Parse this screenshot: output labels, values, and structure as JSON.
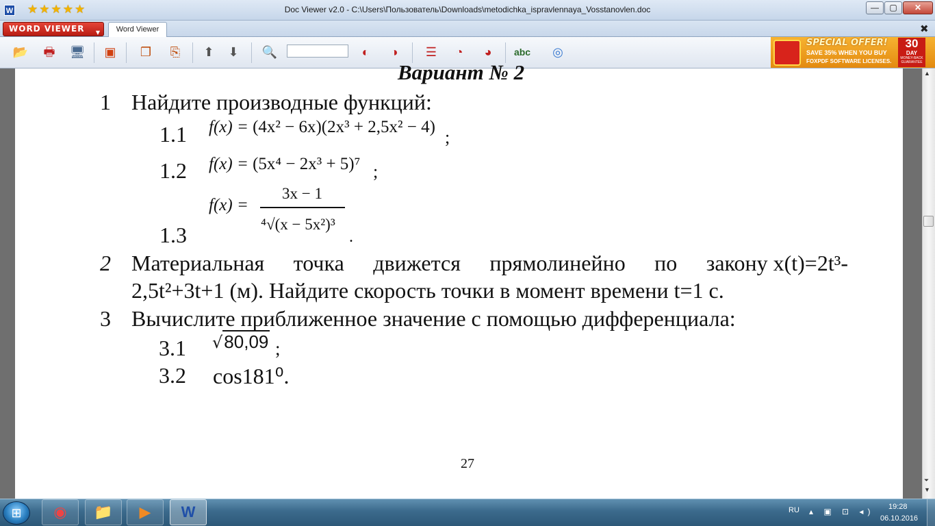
{
  "window": {
    "title": "Doc Viewer v2.0 - C:\\Users\\Пользователь\\Downloads\\metodichka_ispravlennaya_Vosstanovlen.doc",
    "app_icon_letter": "W",
    "rating_stars": "★★★★★",
    "minimize": "—",
    "maximize": "▢",
    "close": "✕"
  },
  "tabs": {
    "brand": "Word Viewer",
    "brand_arrow": "▼",
    "document": "Word Viewer",
    "close_doc": "✖"
  },
  "toolbar": {
    "icons": [
      "folder-open-icon",
      "print-icon",
      "screen-icon",
      "image-icon",
      "copy-page-icon",
      "export-icon",
      "arrow-up-icon",
      "arrow-down-icon",
      "magnifier-icon",
      "search-icon",
      "find-icon",
      "page-setup-icon",
      "print-preview-icon",
      "zoom-icon",
      "spellcheck-icon",
      "globe-icon"
    ],
    "search_value": ""
  },
  "ad": {
    "headline": "SPECIAL OFFER!",
    "line2": "SAVE 35% WHEN YOU BUY",
    "line3": "FOXPDF SOFTWARE LICENSES.",
    "days_number": "30",
    "days_label": "DAY",
    "guarantee": "MONEY-BACK GUARANTEE"
  },
  "document": {
    "variant_heading": "Вариант № 2",
    "q1": {
      "number": "1",
      "text": "Найдите производные функций:"
    },
    "items": {
      "n11": "1.1",
      "n12": "1.2",
      "n13": "1.3",
      "f11_lhs": "f(x) = ",
      "f11_rhs": "(4x² − 6x)(2x³ + 2,5x² − 4)",
      "f11_end": ";",
      "f12_lhs": "f(x) = ",
      "f12_rhs": "(5x⁴ − 2x³ + 5)⁷",
      "f12_end": ";",
      "f13_lhs": "f(x) = ",
      "f13_num": "3x − 1",
      "f13_den": "⁴√(x − 5x²)³",
      "f13_end": "."
    },
    "q2": {
      "number": "2",
      "line1_words": [
        "Материальная",
        "точка",
        "движется",
        "прямолинейно",
        "по",
        "закону x(t)=2t³-"
      ],
      "line2": "2,5t²+3t+1 (м). Найдите скорость точки в момент времени t=1 с."
    },
    "q3": {
      "number": "3",
      "text": "Вычислите приближенное значение с помощью дифференциала:",
      "n31": "3.1",
      "n32": "3.2",
      "sqrt_sign": "√",
      "sqrt_value": "80,09",
      "sqrt_end": ";",
      "cos_text": "cos181⁰."
    },
    "page_number": "27"
  },
  "taskbar": {
    "start_icon": "windows-orb-icon",
    "apps": [
      "chrome-icon",
      "explorer-icon",
      "media-player-icon",
      "word-viewer-icon"
    ],
    "language": "RU",
    "time": "19:28",
    "date": "06.10.2016"
  }
}
